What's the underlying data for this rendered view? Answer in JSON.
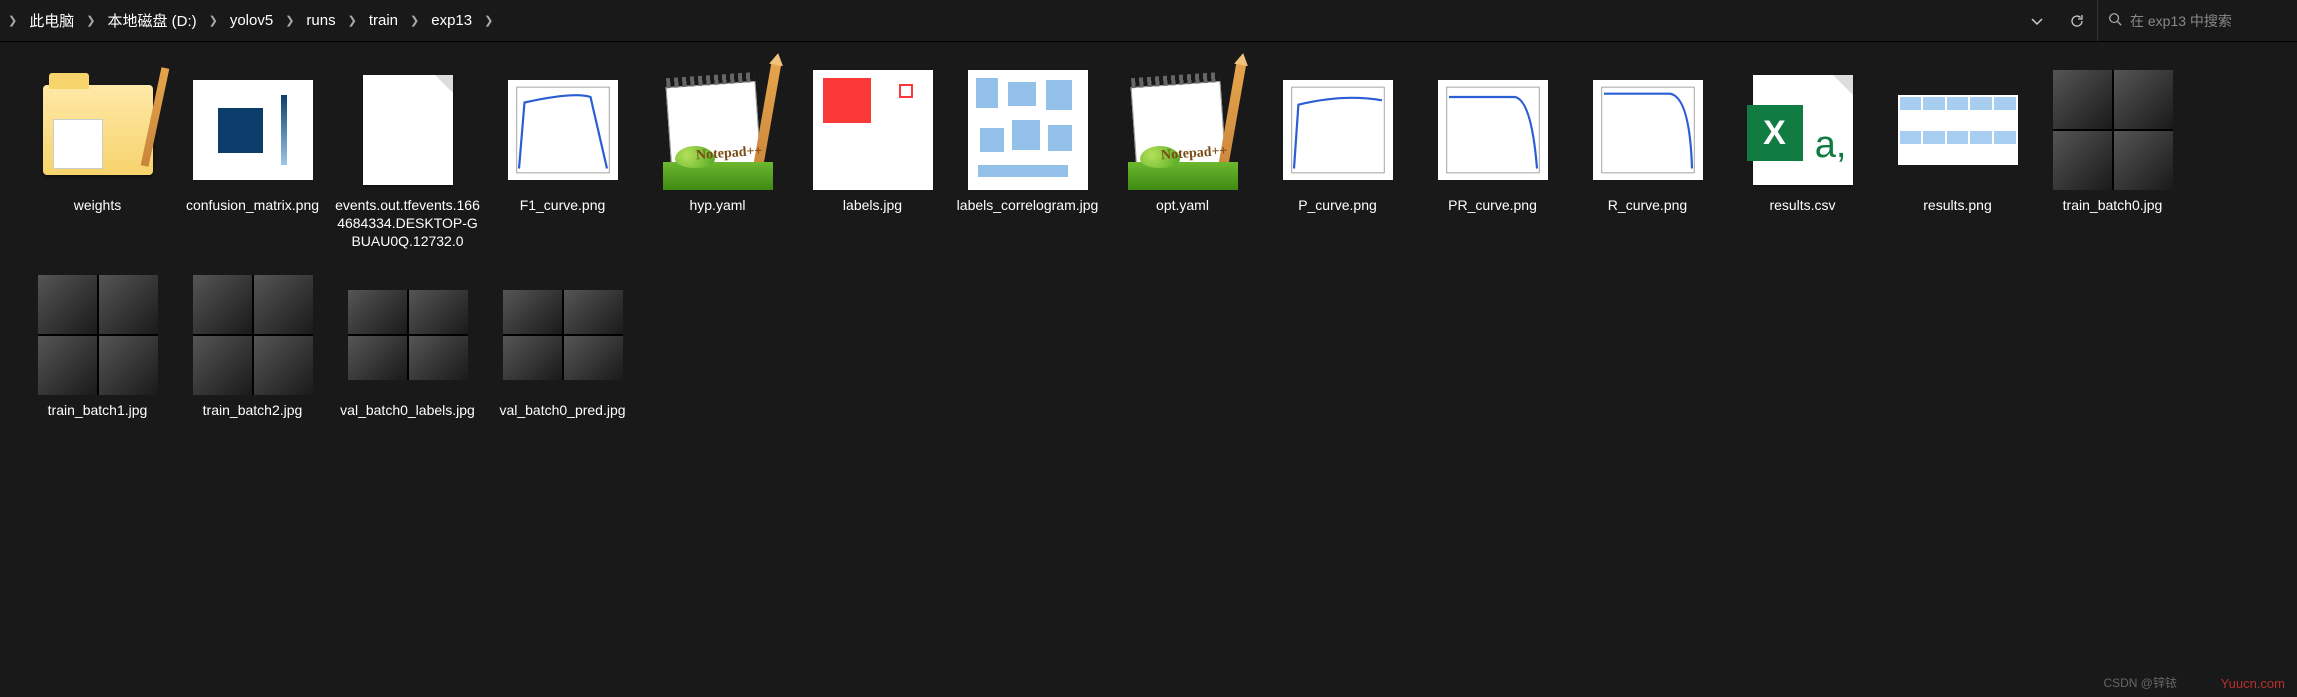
{
  "breadcrumb": {
    "items": [
      {
        "label": "此电脑"
      },
      {
        "label": "本地磁盘 (D:)"
      },
      {
        "label": "yolov5"
      },
      {
        "label": "runs"
      },
      {
        "label": "train"
      },
      {
        "label": "exp13"
      }
    ]
  },
  "search": {
    "placeholder": "在 exp13 中搜索"
  },
  "files": [
    {
      "name": "weights",
      "kind": "folder"
    },
    {
      "name": "confusion_matrix.png",
      "kind": "chart-cm"
    },
    {
      "name": "events.out.tfevents.1664684334.DESKTOP-GBUAU0Q.12732.0",
      "kind": "file"
    },
    {
      "name": "F1_curve.png",
      "kind": "curve-f1"
    },
    {
      "name": "hyp.yaml",
      "kind": "npp"
    },
    {
      "name": "labels.jpg",
      "kind": "labels"
    },
    {
      "name": "labels_correlogram.jpg",
      "kind": "correlogram"
    },
    {
      "name": "opt.yaml",
      "kind": "npp"
    },
    {
      "name": "P_curve.png",
      "kind": "curve-p"
    },
    {
      "name": "PR_curve.png",
      "kind": "curve-pr"
    },
    {
      "name": "R_curve.png",
      "kind": "curve-r"
    },
    {
      "name": "results.csv",
      "kind": "csv"
    },
    {
      "name": "results.png",
      "kind": "results-grid"
    },
    {
      "name": "train_batch0.jpg",
      "kind": "collage"
    },
    {
      "name": "train_batch1.jpg",
      "kind": "collage"
    },
    {
      "name": "train_batch2.jpg",
      "kind": "collage"
    },
    {
      "name": "val_batch0_labels.jpg",
      "kind": "collage-small"
    },
    {
      "name": "val_batch0_pred.jpg",
      "kind": "collage-small"
    }
  ],
  "watermark": {
    "main": "Yuucn.com",
    "sub": "CSDN @锌铱"
  }
}
